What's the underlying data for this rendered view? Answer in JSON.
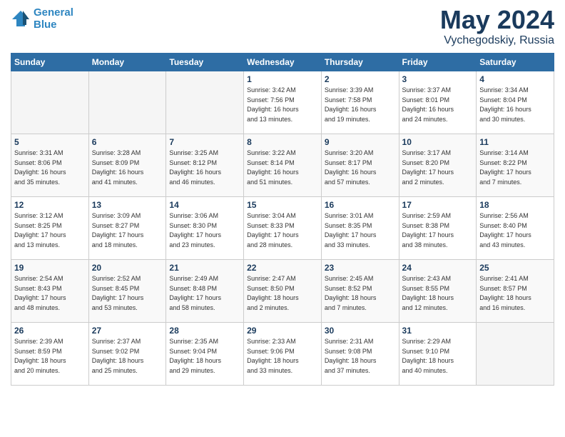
{
  "header": {
    "logo_line1": "General",
    "logo_line2": "Blue",
    "title": "May 2024",
    "location": "Vychegodskiy, Russia"
  },
  "days_of_week": [
    "Sunday",
    "Monday",
    "Tuesday",
    "Wednesday",
    "Thursday",
    "Friday",
    "Saturday"
  ],
  "weeks": [
    [
      {
        "day": "",
        "info": ""
      },
      {
        "day": "",
        "info": ""
      },
      {
        "day": "",
        "info": ""
      },
      {
        "day": "1",
        "info": "Sunrise: 3:42 AM\nSunset: 7:56 PM\nDaylight: 16 hours\nand 13 minutes."
      },
      {
        "day": "2",
        "info": "Sunrise: 3:39 AM\nSunset: 7:58 PM\nDaylight: 16 hours\nand 19 minutes."
      },
      {
        "day": "3",
        "info": "Sunrise: 3:37 AM\nSunset: 8:01 PM\nDaylight: 16 hours\nand 24 minutes."
      },
      {
        "day": "4",
        "info": "Sunrise: 3:34 AM\nSunset: 8:04 PM\nDaylight: 16 hours\nand 30 minutes."
      }
    ],
    [
      {
        "day": "5",
        "info": "Sunrise: 3:31 AM\nSunset: 8:06 PM\nDaylight: 16 hours\nand 35 minutes."
      },
      {
        "day": "6",
        "info": "Sunrise: 3:28 AM\nSunset: 8:09 PM\nDaylight: 16 hours\nand 41 minutes."
      },
      {
        "day": "7",
        "info": "Sunrise: 3:25 AM\nSunset: 8:12 PM\nDaylight: 16 hours\nand 46 minutes."
      },
      {
        "day": "8",
        "info": "Sunrise: 3:22 AM\nSunset: 8:14 PM\nDaylight: 16 hours\nand 51 minutes."
      },
      {
        "day": "9",
        "info": "Sunrise: 3:20 AM\nSunset: 8:17 PM\nDaylight: 16 hours\nand 57 minutes."
      },
      {
        "day": "10",
        "info": "Sunrise: 3:17 AM\nSunset: 8:20 PM\nDaylight: 17 hours\nand 2 minutes."
      },
      {
        "day": "11",
        "info": "Sunrise: 3:14 AM\nSunset: 8:22 PM\nDaylight: 17 hours\nand 7 minutes."
      }
    ],
    [
      {
        "day": "12",
        "info": "Sunrise: 3:12 AM\nSunset: 8:25 PM\nDaylight: 17 hours\nand 13 minutes."
      },
      {
        "day": "13",
        "info": "Sunrise: 3:09 AM\nSunset: 8:27 PM\nDaylight: 17 hours\nand 18 minutes."
      },
      {
        "day": "14",
        "info": "Sunrise: 3:06 AM\nSunset: 8:30 PM\nDaylight: 17 hours\nand 23 minutes."
      },
      {
        "day": "15",
        "info": "Sunrise: 3:04 AM\nSunset: 8:33 PM\nDaylight: 17 hours\nand 28 minutes."
      },
      {
        "day": "16",
        "info": "Sunrise: 3:01 AM\nSunset: 8:35 PM\nDaylight: 17 hours\nand 33 minutes."
      },
      {
        "day": "17",
        "info": "Sunrise: 2:59 AM\nSunset: 8:38 PM\nDaylight: 17 hours\nand 38 minutes."
      },
      {
        "day": "18",
        "info": "Sunrise: 2:56 AM\nSunset: 8:40 PM\nDaylight: 17 hours\nand 43 minutes."
      }
    ],
    [
      {
        "day": "19",
        "info": "Sunrise: 2:54 AM\nSunset: 8:43 PM\nDaylight: 17 hours\nand 48 minutes."
      },
      {
        "day": "20",
        "info": "Sunrise: 2:52 AM\nSunset: 8:45 PM\nDaylight: 17 hours\nand 53 minutes."
      },
      {
        "day": "21",
        "info": "Sunrise: 2:49 AM\nSunset: 8:48 PM\nDaylight: 17 hours\nand 58 minutes."
      },
      {
        "day": "22",
        "info": "Sunrise: 2:47 AM\nSunset: 8:50 PM\nDaylight: 18 hours\nand 2 minutes."
      },
      {
        "day": "23",
        "info": "Sunrise: 2:45 AM\nSunset: 8:52 PM\nDaylight: 18 hours\nand 7 minutes."
      },
      {
        "day": "24",
        "info": "Sunrise: 2:43 AM\nSunset: 8:55 PM\nDaylight: 18 hours\nand 12 minutes."
      },
      {
        "day": "25",
        "info": "Sunrise: 2:41 AM\nSunset: 8:57 PM\nDaylight: 18 hours\nand 16 minutes."
      }
    ],
    [
      {
        "day": "26",
        "info": "Sunrise: 2:39 AM\nSunset: 8:59 PM\nDaylight: 18 hours\nand 20 minutes."
      },
      {
        "day": "27",
        "info": "Sunrise: 2:37 AM\nSunset: 9:02 PM\nDaylight: 18 hours\nand 25 minutes."
      },
      {
        "day": "28",
        "info": "Sunrise: 2:35 AM\nSunset: 9:04 PM\nDaylight: 18 hours\nand 29 minutes."
      },
      {
        "day": "29",
        "info": "Sunrise: 2:33 AM\nSunset: 9:06 PM\nDaylight: 18 hours\nand 33 minutes."
      },
      {
        "day": "30",
        "info": "Sunrise: 2:31 AM\nSunset: 9:08 PM\nDaylight: 18 hours\nand 37 minutes."
      },
      {
        "day": "31",
        "info": "Sunrise: 2:29 AM\nSunset: 9:10 PM\nDaylight: 18 hours\nand 40 minutes."
      },
      {
        "day": "",
        "info": ""
      }
    ]
  ]
}
